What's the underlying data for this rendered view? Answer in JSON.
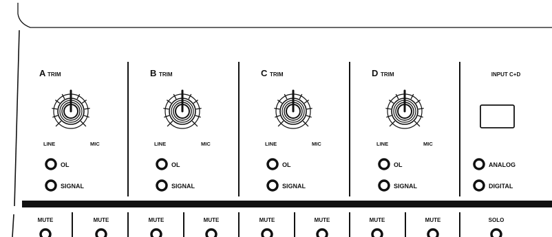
{
  "channels": [
    {
      "trim_letter": "A",
      "trim_word": "TRIM",
      "knob_left_label": "LINE",
      "knob_right_label": "MIC",
      "led_ol_label": "OL",
      "led_signal_label": "SIGNAL"
    },
    {
      "trim_letter": "B",
      "trim_word": "TRIM",
      "knob_left_label": "LINE",
      "knob_right_label": "MIC",
      "led_ol_label": "OL",
      "led_signal_label": "SIGNAL"
    },
    {
      "trim_letter": "C",
      "trim_word": "TRIM",
      "knob_left_label": "LINE",
      "knob_right_label": "MIC",
      "led_ol_label": "OL",
      "led_signal_label": "SIGNAL"
    },
    {
      "trim_letter": "D",
      "trim_word": "TRIM",
      "knob_left_label": "LINE",
      "knob_right_label": "MIC",
      "led_ol_label": "OL",
      "led_signal_label": "SIGNAL"
    }
  ],
  "input_section": {
    "title": "INPUT C+D",
    "analog_label": "ANALOG",
    "digital_label": "DIGITAL"
  },
  "bottom_row": {
    "mute_label": "MUTE",
    "solo_label": "SOLO"
  },
  "colors": {
    "ink": "#111111",
    "background": "#ffffff"
  }
}
